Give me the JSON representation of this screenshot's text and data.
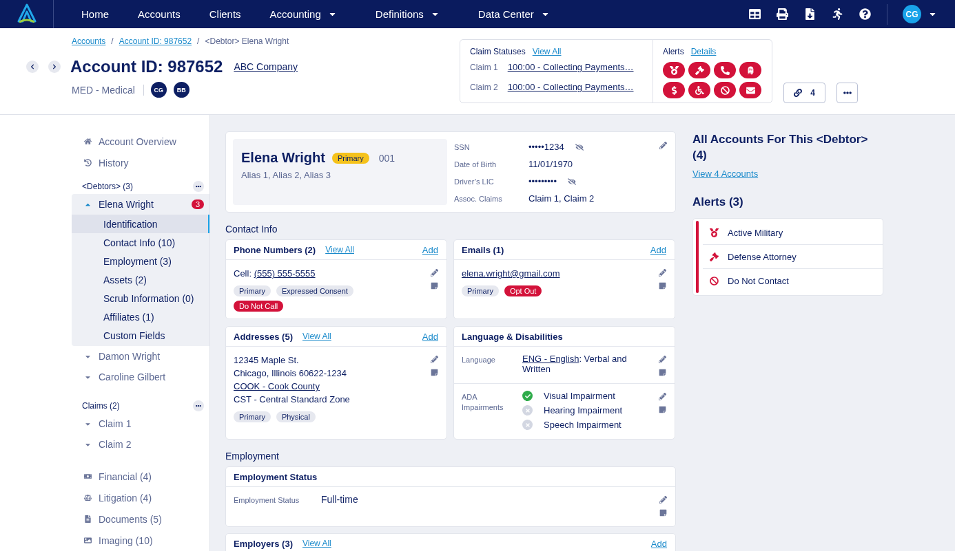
{
  "nav": {
    "items": [
      {
        "label": "Home",
        "has_menu": false
      },
      {
        "label": "Accounts",
        "has_menu": false
      },
      {
        "label": "Clients",
        "has_menu": false
      },
      {
        "label": "Accounting",
        "has_menu": true
      },
      {
        "label": "Definitions",
        "has_menu": true
      },
      {
        "label": "Data Center",
        "has_menu": true
      }
    ],
    "user": "CG"
  },
  "breadcrumb": {
    "separator": "/",
    "items": [
      {
        "label": "Accounts",
        "link": true
      },
      {
        "label": "Account ID: 987652",
        "link": true
      },
      {
        "label": "<Debtor> Elena Wright",
        "link": false
      }
    ]
  },
  "header": {
    "title": "Account ID: 987652",
    "company": "ABC Company",
    "type": "MED - Medical",
    "avatars": [
      "CG",
      "BB"
    ]
  },
  "claim_statuses": {
    "title": "Claim Statuses",
    "link": "View All",
    "rows": [
      {
        "label": "Claim 1",
        "status": "100:00 - Collecting Payments…"
      },
      {
        "label": "Claim 2",
        "status": "100:00 - Collecting Payments…"
      }
    ]
  },
  "alert_badges": {
    "title": "Alerts",
    "link": "Details"
  },
  "links_button": {
    "count": "4"
  },
  "sidebar": {
    "top": [
      {
        "label": "Account Overview"
      },
      {
        "label": "History"
      }
    ],
    "debtors": {
      "title": "<Debtors> (3)",
      "items": [
        {
          "label": "Elena Wright",
          "badge": "3",
          "expanded": true,
          "children": [
            {
              "label": "Identification",
              "selected": true
            },
            {
              "label": "Contact Info (10)",
              "selected": false
            },
            {
              "label": "Employment (3)",
              "selected": false
            },
            {
              "label": "Assets (2)",
              "selected": false
            },
            {
              "label": "Scrub Information (0)",
              "selected": false
            },
            {
              "label": "Affiliates (1)",
              "selected": false
            },
            {
              "label": "Custom Fields",
              "selected": false
            }
          ]
        },
        {
          "label": "Damon Wright",
          "expanded": false
        },
        {
          "label": "Caroline Gilbert",
          "expanded": false
        }
      ]
    },
    "claims": {
      "title": "Claims (2)",
      "items": [
        {
          "label": "Claim 1",
          "expanded": false
        },
        {
          "label": "Claim 2",
          "expanded": false
        }
      ]
    },
    "bottom": [
      {
        "label": "Financial (4)"
      },
      {
        "label": "Litigation (4)"
      },
      {
        "label": "Documents (5)"
      },
      {
        "label": "Imaging (10)"
      }
    ]
  },
  "identity": {
    "name": "Elena Wright",
    "badge": "Primary",
    "code": "001",
    "aliases": "Alias 1, Alias 2, Alias 3",
    "fields": [
      {
        "label": "SSN",
        "value": "•••••1234",
        "concealed": true
      },
      {
        "label": "Date of Birth",
        "value": "11/01/1970",
        "concealed": false
      },
      {
        "label": "Driver’s LIC",
        "value": "•••••••••",
        "concealed": true
      },
      {
        "label": "Assoc. Claims",
        "value": "Claim 1, Claim 2",
        "concealed": false
      }
    ]
  },
  "contact_info": {
    "title": "Contact Info",
    "phones": {
      "title": "Phone Numbers (2)",
      "view_all": "View All",
      "add": "Add",
      "entry": {
        "prefix": "Cell: ",
        "link": "(555) 555-5555"
      },
      "tags": [
        {
          "label": "Primary",
          "kind": "neutral"
        },
        {
          "label": "Expressed Consent",
          "kind": "neutral"
        },
        {
          "label": "Do Not Call",
          "kind": "alert"
        }
      ]
    },
    "emails": {
      "title": "Emails (1)",
      "add": "Add",
      "entry": {
        "link": "elena.wright@gmail.com"
      },
      "tags": [
        {
          "label": "Primary",
          "kind": "neutral"
        },
        {
          "label": "Opt Out",
          "kind": "alert"
        }
      ]
    },
    "addresses": {
      "title": "Addresses (5)",
      "view_all": "View All",
      "add": "Add",
      "lines": [
        {
          "text": "12345 Maple St.",
          "link": false
        },
        {
          "text": "Chicago, Illinois 60622-1234",
          "link": false
        },
        {
          "text": "COOK - Cook County",
          "link": true
        },
        {
          "text": "CST - Central Standard Zone",
          "link": false
        }
      ],
      "tags": [
        {
          "label": "Primary",
          "kind": "neutral"
        },
        {
          "label": "Physical",
          "kind": "neutral"
        }
      ]
    },
    "language": {
      "title": "Language & Disabilities",
      "language_label": "Language",
      "language_link": "ENG - English",
      "language_rest": ": Verbal and Written",
      "ada_label": "ADA Impairments",
      "impairments": [
        {
          "label": "Visual Impairment",
          "checked": true
        },
        {
          "label": "Hearing Impairment",
          "checked": false
        },
        {
          "label": "Speech Impairment",
          "checked": false
        }
      ]
    }
  },
  "employment": {
    "title": "Employment",
    "status_card": {
      "title": "Employment Status",
      "label": "Employment Status",
      "value": "Full-time"
    },
    "employers": {
      "title": "Employers (3)",
      "view_all": "View All",
      "add": "Add"
    }
  },
  "accounts": {
    "title": "All Accounts For This <Debtor> (4)",
    "link": "View 4 Accounts"
  },
  "alerts": {
    "title": "Alerts (3)",
    "items": [
      {
        "label": "Active Military"
      },
      {
        "label": "Defense Attorney"
      },
      {
        "label": "Do Not Contact"
      }
    ]
  }
}
